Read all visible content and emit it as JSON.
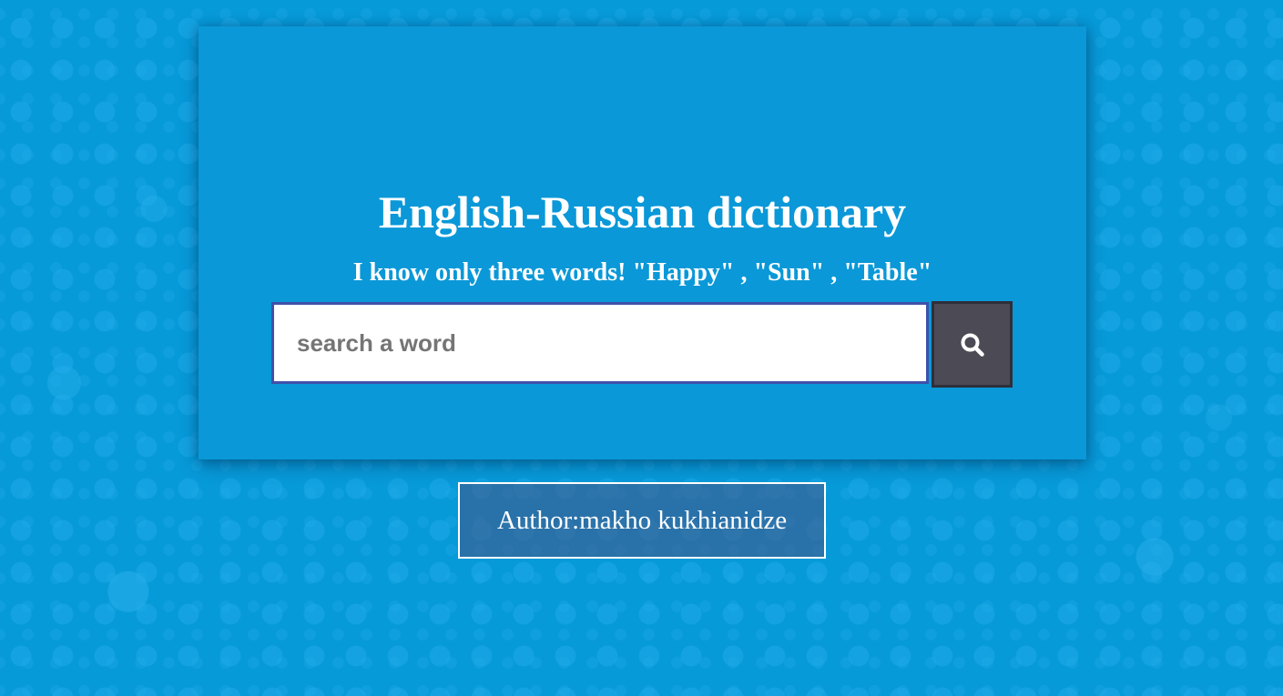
{
  "header": {
    "title": "English-Russian dictionary",
    "subtitle": "I know only three words! \"Happy\" , \"Sun\" , \"Table\""
  },
  "search": {
    "placeholder": "search a word",
    "value": "",
    "button_icon": "search-icon"
  },
  "footer": {
    "author": "Author:makho kukhianidze"
  },
  "colors": {
    "background": "#079ad9",
    "card": "#0a98d8",
    "input_border": "#3f51a9",
    "button": "#4b4a55",
    "text": "#ffffff"
  }
}
